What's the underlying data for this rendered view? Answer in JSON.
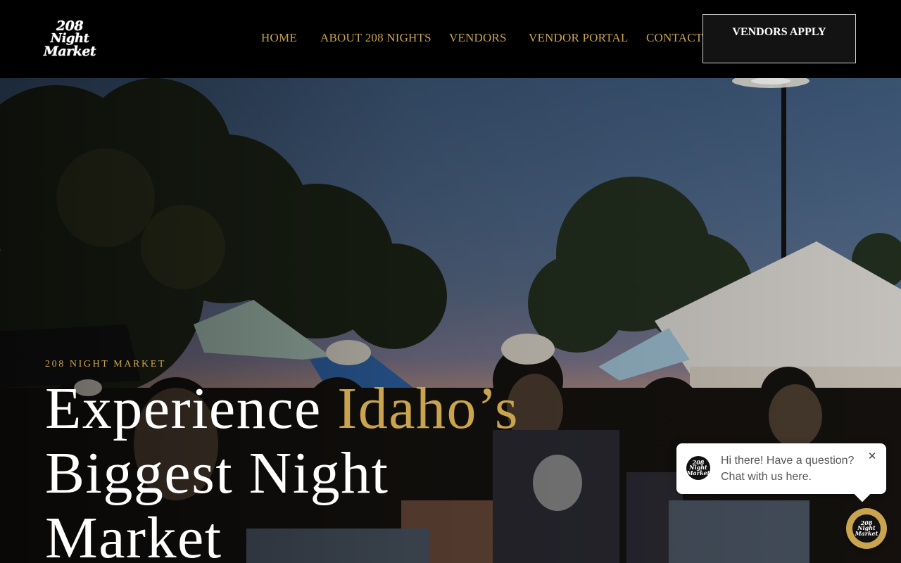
{
  "header": {
    "logo_lines": [
      "208",
      "Night",
      "Market"
    ],
    "nav": [
      "HOME",
      "ABOUT 208 NIGHTS",
      "VENDORS",
      "VENDOR PORTAL",
      "CONTACT"
    ],
    "cta_label": "VENDORS APPLY"
  },
  "hero": {
    "eyebrow": "208 NIGHT MARKET",
    "headline_part1": "Experience ",
    "headline_gold": "Idaho’s",
    "headline_line2": "Biggest Night",
    "headline_line3": "Market"
  },
  "chat": {
    "message_line1": "Hi there! Have a question?",
    "message_line2": "Chat with us here.",
    "close_icon": "close-icon",
    "avatar_lines": [
      "208",
      "Night",
      "Market"
    ]
  },
  "colors": {
    "accent_gold": "#c9a34e",
    "header_bg": "#000000"
  }
}
